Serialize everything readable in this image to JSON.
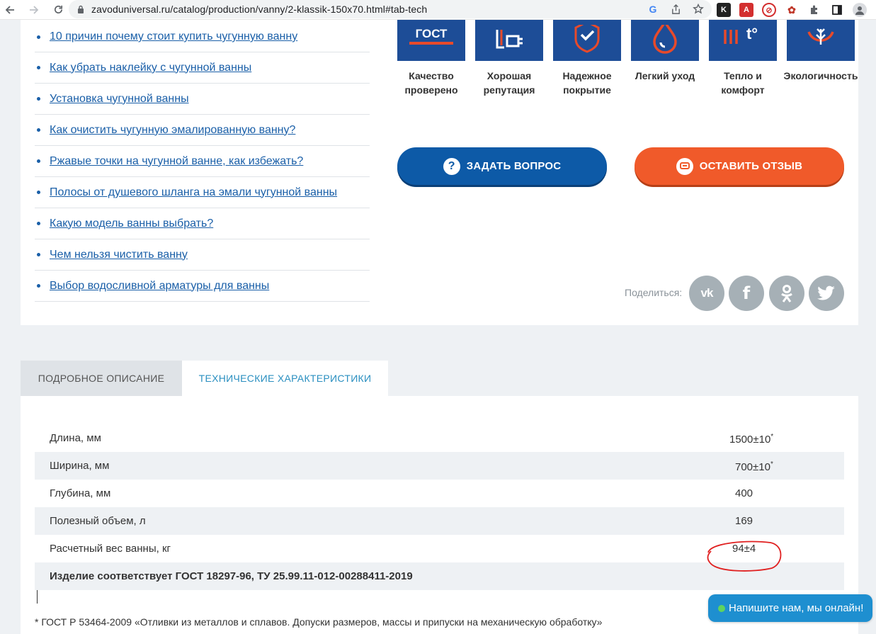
{
  "browser": {
    "url": "zavoduniversal.ru/catalog/production/vanny/2-klassik-150x70.html#tab-tech"
  },
  "articles": [
    {
      "label": " 10 причин почему стоит купить чугунную ванну"
    },
    {
      "label": " Как убрать наклейку с чугунной ванны"
    },
    {
      "label": " Установка чугунной ванны"
    },
    {
      "label": " Как очистить чугунную эмалированную ванну?"
    },
    {
      "label": " Ржавые точки на чугунной ванне, как избежать?"
    },
    {
      "label": " Полосы от душевого шланга на эмали чугунной ванны"
    },
    {
      "label": " Какую модель ванны выбрать?"
    },
    {
      "label": " Чем нельзя чистить ванну"
    },
    {
      "label": " Выбор водосливной арматуры для ванны"
    }
  ],
  "features": [
    {
      "icon": "gost-icon",
      "line1": "Качество",
      "line2": "проверено"
    },
    {
      "icon": "reputation-icon",
      "line1": "Хорошая",
      "line2": "репутация"
    },
    {
      "icon": "shield-check-icon",
      "line1": "Надежное",
      "line2": "покрытие"
    },
    {
      "icon": "drop-icon",
      "line1": "Легкий уход",
      "line2": ""
    },
    {
      "icon": "heat-icon",
      "line1": "Тепло и",
      "line2": "комфорт"
    },
    {
      "icon": "eco-leaf-icon",
      "line1": "Экологичность",
      "line2": ""
    }
  ],
  "gost_badge_text": "ГОСТ",
  "heat_badge_text": "t°",
  "buttons": {
    "ask": "ЗАДАТЬ ВОПРОС",
    "review": "ОСТАВИТЬ ОТЗЫВ"
  },
  "share": {
    "label": "Поделиться:",
    "networks": [
      "vk",
      "facebook",
      "odnoklassniki",
      "twitter"
    ]
  },
  "tabs": {
    "description": "ПОДРОБНОЕ ОПИСАНИЕ",
    "tech": "ТЕХНИЧЕСКИЕ ХАРАКТЕРИСТИКИ"
  },
  "specs": [
    {
      "name": "Длина, мм",
      "value": "1500±10",
      "sup": "*"
    },
    {
      "name": "Ширина, мм",
      "value": "700±10",
      "sup": "*"
    },
    {
      "name": "Глубина, мм",
      "value": "400",
      "sup": ""
    },
    {
      "name": "Полезный объем, л",
      "value": "169",
      "sup": ""
    },
    {
      "name": "Расчетный вес ванны, кг",
      "value": "94±4",
      "sup": ""
    },
    {
      "name": "Изделие соответствует ГОСТ 18297-96, ТУ 25.99.11-012-00288411-2019",
      "value": "",
      "sup": ""
    }
  ],
  "footnote": "* ГОСТ Р 53464-2009 «Отливки из металлов и сплавов. Допуски размеров, массы и припуски на механическую обработку»",
  "chat": {
    "label": "Напишите нам, мы онлайн!"
  },
  "colors": {
    "brand_blue": "#1d4d97",
    "ask_button": "#0d5aa7",
    "review_button": "#f05a2a",
    "tab_active": "#2a8fc0",
    "annotation_red": "#e02020"
  }
}
